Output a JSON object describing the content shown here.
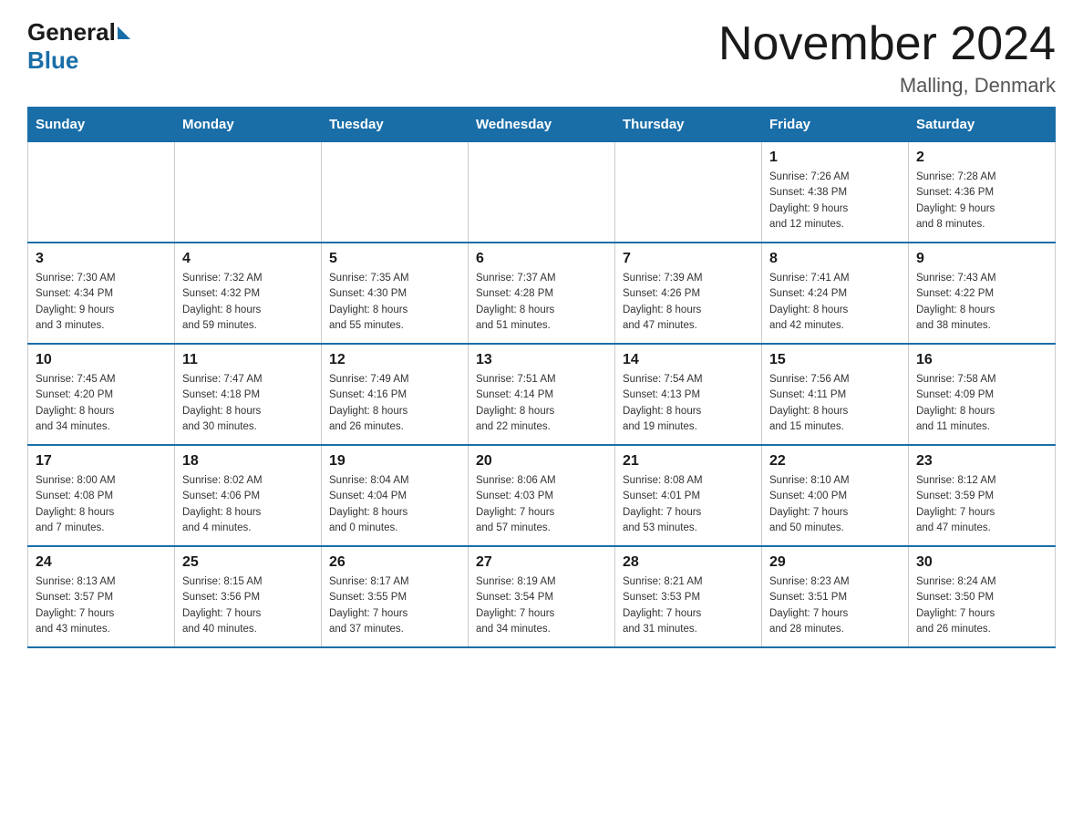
{
  "header": {
    "logo_general": "General",
    "logo_blue": "Blue",
    "month_title": "November 2024",
    "location": "Malling, Denmark"
  },
  "weekdays": [
    "Sunday",
    "Monday",
    "Tuesday",
    "Wednesday",
    "Thursday",
    "Friday",
    "Saturday"
  ],
  "weeks": [
    [
      {
        "day": "",
        "info": ""
      },
      {
        "day": "",
        "info": ""
      },
      {
        "day": "",
        "info": ""
      },
      {
        "day": "",
        "info": ""
      },
      {
        "day": "",
        "info": ""
      },
      {
        "day": "1",
        "info": "Sunrise: 7:26 AM\nSunset: 4:38 PM\nDaylight: 9 hours\nand 12 minutes."
      },
      {
        "day": "2",
        "info": "Sunrise: 7:28 AM\nSunset: 4:36 PM\nDaylight: 9 hours\nand 8 minutes."
      }
    ],
    [
      {
        "day": "3",
        "info": "Sunrise: 7:30 AM\nSunset: 4:34 PM\nDaylight: 9 hours\nand 3 minutes."
      },
      {
        "day": "4",
        "info": "Sunrise: 7:32 AM\nSunset: 4:32 PM\nDaylight: 8 hours\nand 59 minutes."
      },
      {
        "day": "5",
        "info": "Sunrise: 7:35 AM\nSunset: 4:30 PM\nDaylight: 8 hours\nand 55 minutes."
      },
      {
        "day": "6",
        "info": "Sunrise: 7:37 AM\nSunset: 4:28 PM\nDaylight: 8 hours\nand 51 minutes."
      },
      {
        "day": "7",
        "info": "Sunrise: 7:39 AM\nSunset: 4:26 PM\nDaylight: 8 hours\nand 47 minutes."
      },
      {
        "day": "8",
        "info": "Sunrise: 7:41 AM\nSunset: 4:24 PM\nDaylight: 8 hours\nand 42 minutes."
      },
      {
        "day": "9",
        "info": "Sunrise: 7:43 AM\nSunset: 4:22 PM\nDaylight: 8 hours\nand 38 minutes."
      }
    ],
    [
      {
        "day": "10",
        "info": "Sunrise: 7:45 AM\nSunset: 4:20 PM\nDaylight: 8 hours\nand 34 minutes."
      },
      {
        "day": "11",
        "info": "Sunrise: 7:47 AM\nSunset: 4:18 PM\nDaylight: 8 hours\nand 30 minutes."
      },
      {
        "day": "12",
        "info": "Sunrise: 7:49 AM\nSunset: 4:16 PM\nDaylight: 8 hours\nand 26 minutes."
      },
      {
        "day": "13",
        "info": "Sunrise: 7:51 AM\nSunset: 4:14 PM\nDaylight: 8 hours\nand 22 minutes."
      },
      {
        "day": "14",
        "info": "Sunrise: 7:54 AM\nSunset: 4:13 PM\nDaylight: 8 hours\nand 19 minutes."
      },
      {
        "day": "15",
        "info": "Sunrise: 7:56 AM\nSunset: 4:11 PM\nDaylight: 8 hours\nand 15 minutes."
      },
      {
        "day": "16",
        "info": "Sunrise: 7:58 AM\nSunset: 4:09 PM\nDaylight: 8 hours\nand 11 minutes."
      }
    ],
    [
      {
        "day": "17",
        "info": "Sunrise: 8:00 AM\nSunset: 4:08 PM\nDaylight: 8 hours\nand 7 minutes."
      },
      {
        "day": "18",
        "info": "Sunrise: 8:02 AM\nSunset: 4:06 PM\nDaylight: 8 hours\nand 4 minutes."
      },
      {
        "day": "19",
        "info": "Sunrise: 8:04 AM\nSunset: 4:04 PM\nDaylight: 8 hours\nand 0 minutes."
      },
      {
        "day": "20",
        "info": "Sunrise: 8:06 AM\nSunset: 4:03 PM\nDaylight: 7 hours\nand 57 minutes."
      },
      {
        "day": "21",
        "info": "Sunrise: 8:08 AM\nSunset: 4:01 PM\nDaylight: 7 hours\nand 53 minutes."
      },
      {
        "day": "22",
        "info": "Sunrise: 8:10 AM\nSunset: 4:00 PM\nDaylight: 7 hours\nand 50 minutes."
      },
      {
        "day": "23",
        "info": "Sunrise: 8:12 AM\nSunset: 3:59 PM\nDaylight: 7 hours\nand 47 minutes."
      }
    ],
    [
      {
        "day": "24",
        "info": "Sunrise: 8:13 AM\nSunset: 3:57 PM\nDaylight: 7 hours\nand 43 minutes."
      },
      {
        "day": "25",
        "info": "Sunrise: 8:15 AM\nSunset: 3:56 PM\nDaylight: 7 hours\nand 40 minutes."
      },
      {
        "day": "26",
        "info": "Sunrise: 8:17 AM\nSunset: 3:55 PM\nDaylight: 7 hours\nand 37 minutes."
      },
      {
        "day": "27",
        "info": "Sunrise: 8:19 AM\nSunset: 3:54 PM\nDaylight: 7 hours\nand 34 minutes."
      },
      {
        "day": "28",
        "info": "Sunrise: 8:21 AM\nSunset: 3:53 PM\nDaylight: 7 hours\nand 31 minutes."
      },
      {
        "day": "29",
        "info": "Sunrise: 8:23 AM\nSunset: 3:51 PM\nDaylight: 7 hours\nand 28 minutes."
      },
      {
        "day": "30",
        "info": "Sunrise: 8:24 AM\nSunset: 3:50 PM\nDaylight: 7 hours\nand 26 minutes."
      }
    ]
  ]
}
